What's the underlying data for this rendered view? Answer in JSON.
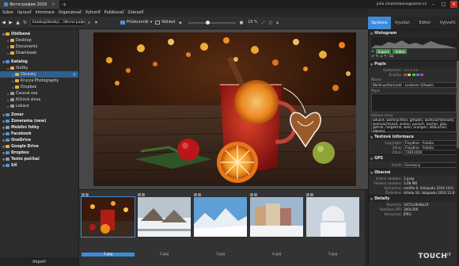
{
  "app": {
    "tab_title": "Фотографии 2016",
    "user": "julia.chukotskava@zoner.cz"
  },
  "menu": [
    "Súbor",
    "Upraviť",
    "Informace",
    "Organizovať",
    "Vytvoriť",
    "Publikovať",
    "Zobraziť"
  ],
  "toolbar": {
    "path": "Katalog\\Skolky\\...\\Фотографии 2016",
    "sort_label": "Průzkumník",
    "view_label": "Náhled",
    "zoom": "16 %"
  },
  "sidebar": {
    "items": [
      {
        "label": "Oblíbené",
        "level": 0,
        "header": true,
        "icon": "star-icon"
      },
      {
        "label": "Desktop",
        "level": 1,
        "icon": "folder-icon"
      },
      {
        "label": "Documents",
        "level": 1,
        "icon": "folder-icon"
      },
      {
        "label": "Downloads",
        "level": 1,
        "icon": "folder-icon"
      },
      {
        "label": "Katalog",
        "level": 0,
        "header": true,
        "icon": "catalog-icon"
      },
      {
        "label": "Složky",
        "level": 1,
        "icon": "folder-icon"
      },
      {
        "label": "Obrázky",
        "level": 2,
        "icon": "folder-icon",
        "selected": true
      },
      {
        "label": "Krucza Photography",
        "level": 2,
        "icon": "folder-icon"
      },
      {
        "label": "Dropbox",
        "level": 2,
        "icon": "folder-icon"
      },
      {
        "label": "Časová osa",
        "level": 1,
        "icon": "timeline-icon"
      },
      {
        "label": "Klíčová slova",
        "level": 1,
        "icon": "tag-icon"
      },
      {
        "label": "Lokace",
        "level": 1,
        "icon": "pin-icon"
      },
      {
        "label": "Zoner",
        "level": 0,
        "header": true,
        "icon": "cloud-icon"
      },
      {
        "label": "Zonerama (new)",
        "level": 0,
        "header": true,
        "icon": "cloud-icon"
      },
      {
        "label": "Mobilní fotky",
        "level": 0,
        "header": true,
        "icon": "phone-icon"
      },
      {
        "label": "Facebook",
        "level": 0,
        "header": true,
        "icon": "facebook-icon"
      },
      {
        "label": "OneDrive",
        "level": 0,
        "header": true,
        "icon": "cloud-icon"
      },
      {
        "label": "Google Drive",
        "level": 0,
        "header": true,
        "icon": "drive-icon"
      },
      {
        "label": "Dropbox",
        "level": 0,
        "header": true,
        "icon": "dropbox-icon"
      },
      {
        "label": "Tento počítač",
        "level": 0,
        "header": true,
        "icon": "computer-icon"
      },
      {
        "label": "Síť",
        "level": 0,
        "header": true,
        "icon": "network-icon"
      }
    ],
    "import_label": "Import"
  },
  "filmstrip": {
    "thumbs": [
      {
        "label": "1.jpg",
        "selected": true
      },
      {
        "label": "2.jpg"
      },
      {
        "label": "3.jpg"
      },
      {
        "label": "4.jpg"
      },
      {
        "label": "5.jpg"
      }
    ]
  },
  "right_tabs": [
    "Správce",
    "Vyvolat",
    "Editor",
    "Vytvořit"
  ],
  "right_panel": {
    "histogram_title": "Histogram",
    "export_label": "Export",
    "share_label": "Sdílet",
    "popis_title": "Popis",
    "hodnoceni_label": "Hodnocení:",
    "znacka_label": "Značka:",
    "nazev_label": "Název",
    "nazev_value": "Weihnachtsmarkt - Leckerer Glhwein",
    "popis_label": "Popis",
    "klicova_label": "Klíčová slova",
    "klicova_value": "advent, weihnachten, glhwein, weihnachtsmarkt, weihnachtszeit, winter, punsch, becher, glas, getrnk, heigetrnk, wein, orangen, lebkuchen, alkohol,",
    "textove_title": "Textové informace",
    "copyright_label": "Copyright:",
    "copyright_value": "Floydine - Fotolia",
    "zdroj_label": "Zdroj:",
    "zdroj_value": "Floydine - Fotolia",
    "zdroj2_label": "Zdroj:",
    "zdroj2_value": "72811650",
    "gps_title": "GPS",
    "zeme_label": "Země:",
    "zeme_value": "Germany",
    "obecne_title": "Obecné",
    "jmeno_label": "Jméno souboru:",
    "jmeno_value": "1.jpeg",
    "velikost_label": "Velikost souboru:",
    "velikost_value": "3.08 MB",
    "vytvoreno_label": "Vytvořeno:",
    "vytvoreno_value": "neděle 6. listopadu 2016 18:5",
    "zmeneno_label": "Změněno:",
    "zmeneno_value": "středa 16. listopadu 2016 11:0",
    "detaily_title": "Detaily",
    "rozmery_label": "Rozměry:",
    "rozmery_value": "3472x3648x24",
    "rozliseni_label": "Rozlišení DPI:",
    "rozliseni_value": "300x300",
    "komprese_label": "Komprese:",
    "komprese_value": "JPEG"
  },
  "watermark": {
    "text": "TOUCH",
    "sup": "IT"
  },
  "colors": {
    "accent": "#3d8bd9",
    "green": "#3f8f3f"
  }
}
